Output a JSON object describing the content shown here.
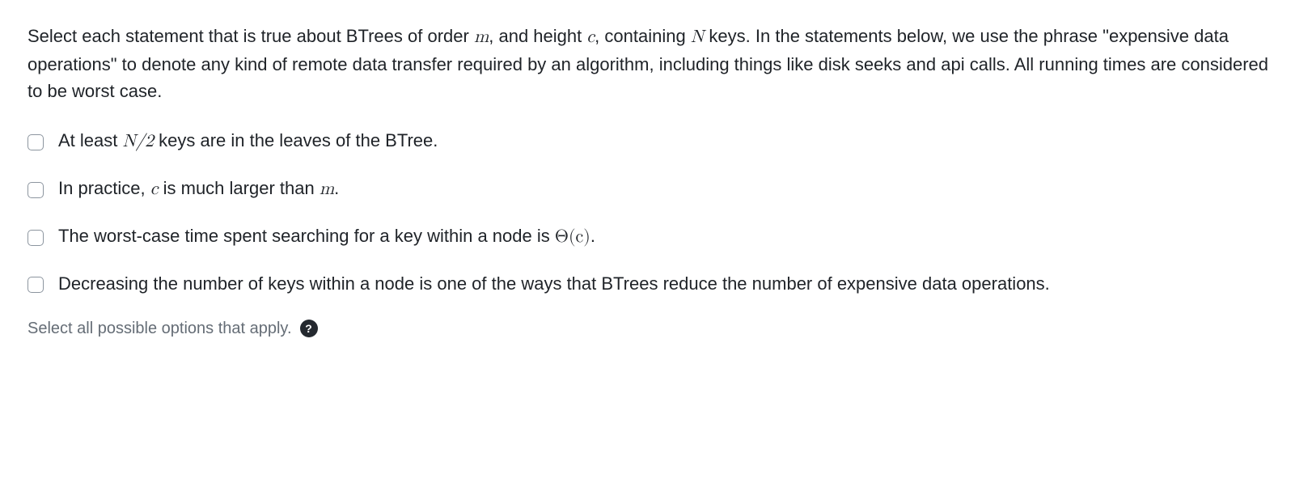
{
  "prompt": {
    "p1": "Select each statement that is true about BTrees of order ",
    "v1": "m",
    "p2": ", and height ",
    "v2": "c",
    "p3": ", containing ",
    "v3": "N",
    "p4": " keys. In the statements below, we use the phrase \"expensive data operations\" to denote any kind of remote data transfer required by an algorithm, including things like disk seeks and api calls. All running times are considered to be worst case."
  },
  "options": [
    {
      "t1": "At least ",
      "m1": "N/2",
      "t2": " keys are in the leaves of the BTree."
    },
    {
      "t1": "In practice, ",
      "m1": "c",
      "t2": " is much larger than ",
      "m2": "m",
      "t3": "."
    },
    {
      "t1": "The worst-case time spent searching for a key within a node is ",
      "m1": "Θ(c)",
      "t2": "."
    },
    {
      "t1": "Decreasing the number of keys within a node is one of the ways that BTrees reduce the number of expensive data operations."
    }
  ],
  "hint": "Select all possible options that apply.",
  "help_glyph": "?"
}
